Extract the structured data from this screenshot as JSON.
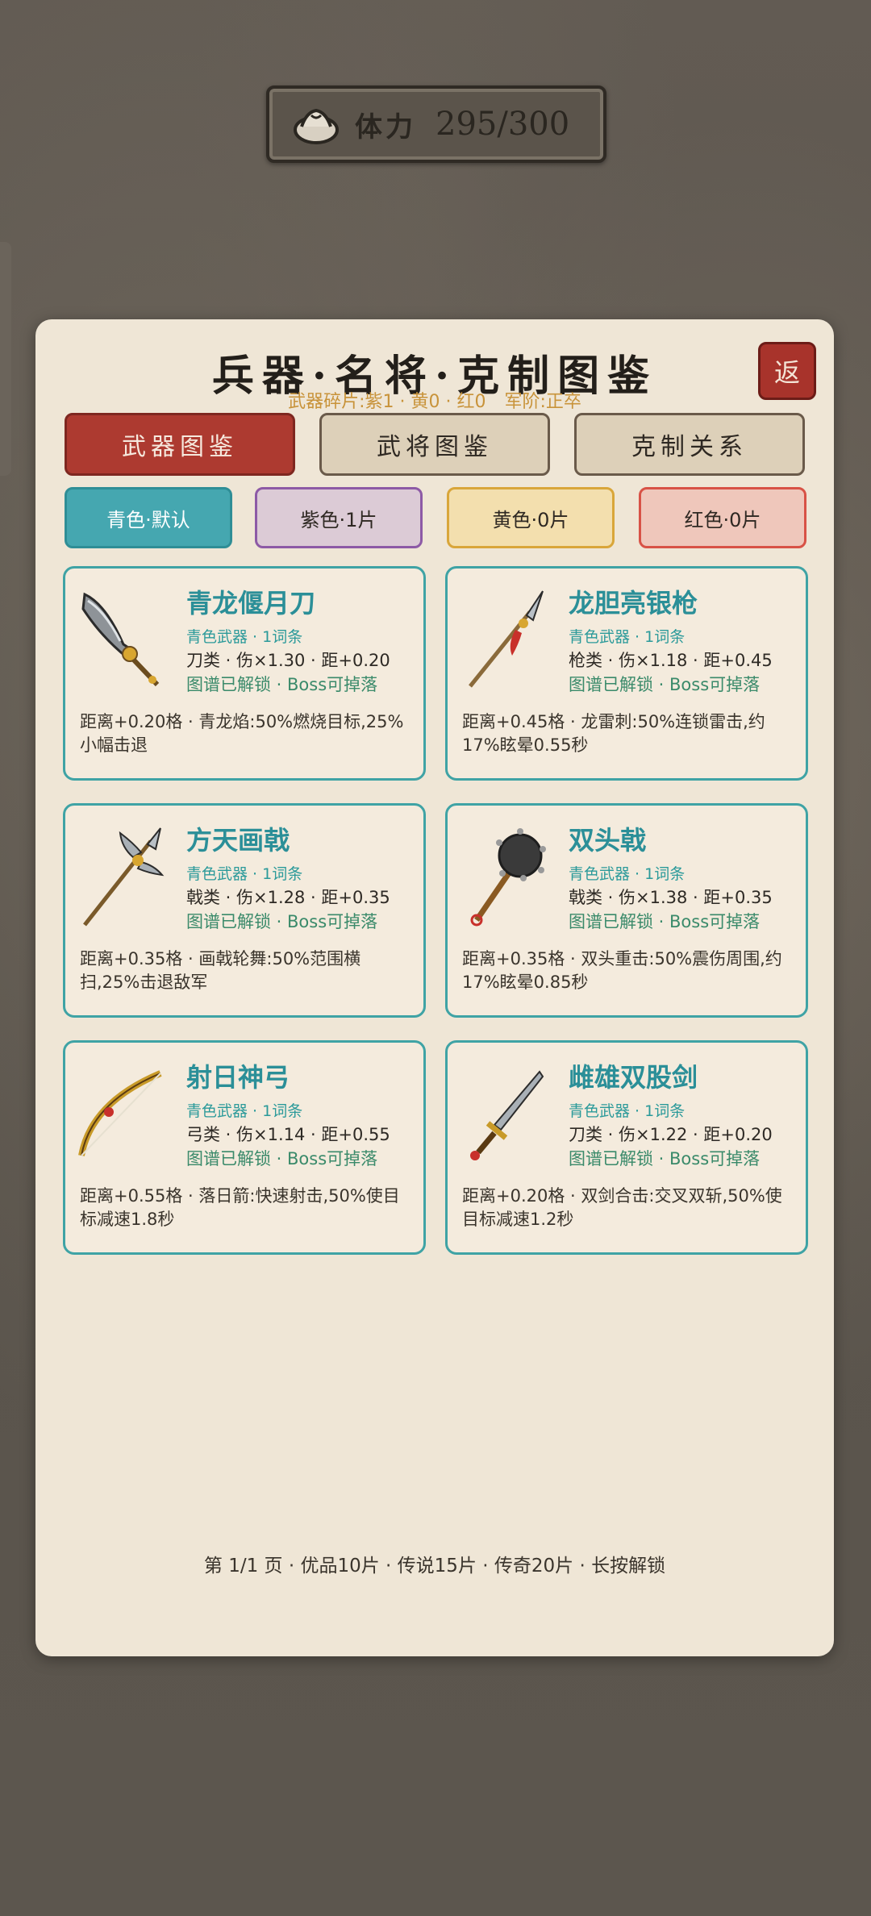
{
  "stamina": {
    "label": "体力",
    "value": "295/300"
  },
  "panel": {
    "title": "兵器·名将·克制图鉴",
    "subtitle_fragments": "武器碎片:紫1 · 黄0 · 红0",
    "subtitle_rank": "军阶:正卒",
    "back_label": "返"
  },
  "tabs": [
    {
      "label": "武器图鉴",
      "active": true
    },
    {
      "label": "武将图鉴",
      "active": false
    },
    {
      "label": "克制关系",
      "active": false
    }
  ],
  "filters": [
    {
      "label": "青色·默认",
      "bg": "#45a7b0",
      "border": "#2f8e96",
      "color": "#ffffff"
    },
    {
      "label": "紫色·1片",
      "bg": "#dccbd6",
      "border": "#8d5aa6",
      "color": "#2e2822"
    },
    {
      "label": "黄色·0片",
      "bg": "#f3dfae",
      "border": "#d9a63a",
      "color": "#2e2822"
    },
    {
      "label": "红色·0片",
      "bg": "#efc7bb",
      "border": "#d85246",
      "color": "#2e2822"
    }
  ],
  "weapons": [
    {
      "name": "青龙偃月刀",
      "icon": "glaive-icon",
      "tier": "青色武器 · 1词条",
      "stats": "刀类 · 伤×1.30 · 距+0.20",
      "status": "图谱已解锁 · Boss可掉落",
      "desc": "距离+0.20格 · 青龙焰:50%燃烧目标,25%小幅击退"
    },
    {
      "name": "龙胆亮银枪",
      "icon": "spear-icon",
      "tier": "青色武器 · 1词条",
      "stats": "枪类 · 伤×1.18 · 距+0.45",
      "status": "图谱已解锁 · Boss可掉落",
      "desc": "距离+0.45格 · 龙雷刺:50%连锁雷击,约17%眩晕0.55秒"
    },
    {
      "name": "方天画戟",
      "icon": "halberd-icon",
      "tier": "青色武器 · 1词条",
      "stats": "戟类 · 伤×1.28 · 距+0.35",
      "status": "图谱已解锁 · Boss可掉落",
      "desc": "距离+0.35格 · 画戟轮舞:50%范围横扫,25%击退敌军"
    },
    {
      "name": "双头戟",
      "icon": "spiked-mace-icon",
      "tier": "青色武器 · 1词条",
      "stats": "戟类 · 伤×1.38 · 距+0.35",
      "status": "图谱已解锁 · Boss可掉落",
      "desc": "距离+0.35格 · 双头重击:50%震伤周围,约17%眩晕0.85秒"
    },
    {
      "name": "射日神弓",
      "icon": "bow-icon",
      "tier": "青色武器 · 1词条",
      "stats": "弓类 · 伤×1.14 · 距+0.55",
      "status": "图谱已解锁 · Boss可掉落",
      "desc": "距离+0.55格 · 落日箭:快速射击,50%使目标减速1.8秒"
    },
    {
      "name": "雌雄双股剑",
      "icon": "sword-icon",
      "tier": "青色武器 · 1词条",
      "stats": "刀类 · 伤×1.22 · 距+0.20",
      "status": "图谱已解锁 · Boss可掉落",
      "desc": "距离+0.20格 · 双剑合击:交叉双斩,50%使目标减速1.2秒"
    }
  ],
  "footer": "第 1/1 页 · 优品10片 · 传说15片 · 传奇20片 · 长按解锁"
}
